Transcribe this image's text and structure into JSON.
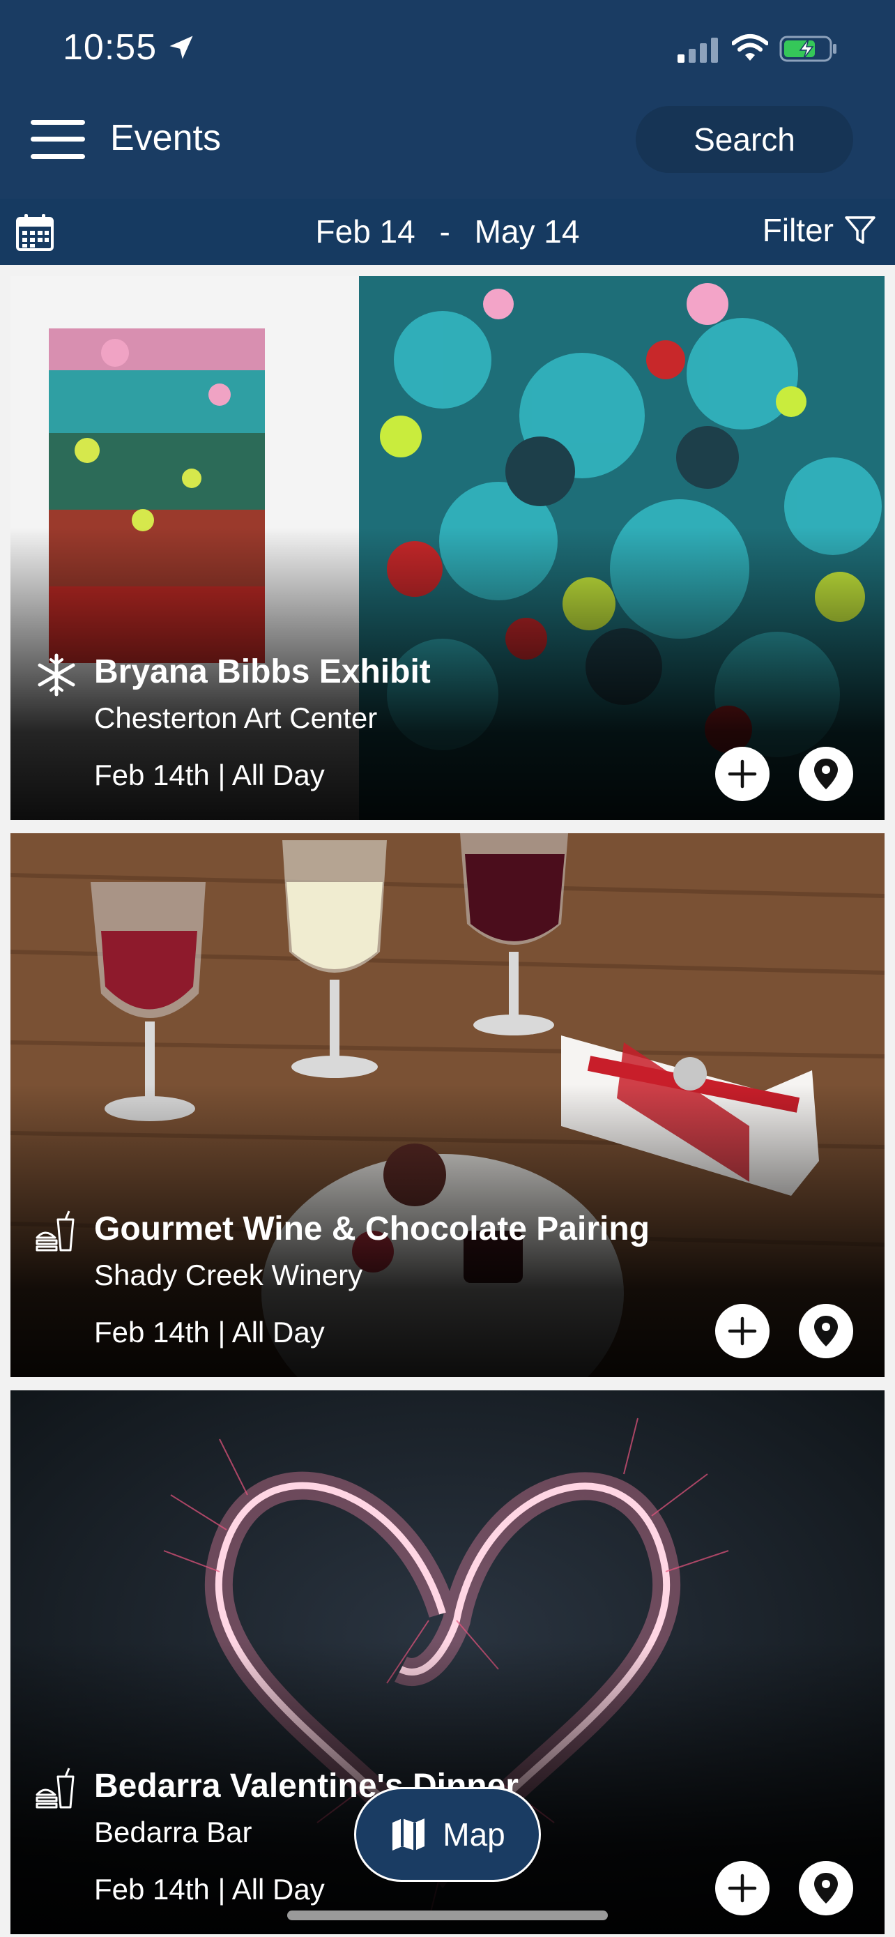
{
  "status_bar": {
    "time": "10:55"
  },
  "header": {
    "title": "Events",
    "search_label": "Search"
  },
  "date_bar": {
    "start": "Feb 14",
    "separator": "-",
    "end": "May 14",
    "filter_label": "Filter"
  },
  "events": [
    {
      "title": "Bryana Bibbs Exhibit",
      "venue": "Chesterton Art Center",
      "date": "Feb 14th | All Day",
      "category_icon": "snowflake-icon"
    },
    {
      "title": "Gourmet Wine & Chocolate Pairing",
      "venue": "Shady Creek Winery",
      "date": "Feb 14th | All Day",
      "category_icon": "food-drink-icon"
    },
    {
      "title": "Bedarra Valentine's Dinner",
      "venue": "Bedarra Bar",
      "date": "Feb 14th | All Day",
      "category_icon": "food-drink-icon"
    }
  ],
  "map_button": {
    "label": "Map"
  },
  "colors": {
    "header_bg": "#1a3c63",
    "datebar_bg": "#163a61",
    "search_bg": "#163455",
    "battery_green": "#35c759"
  }
}
